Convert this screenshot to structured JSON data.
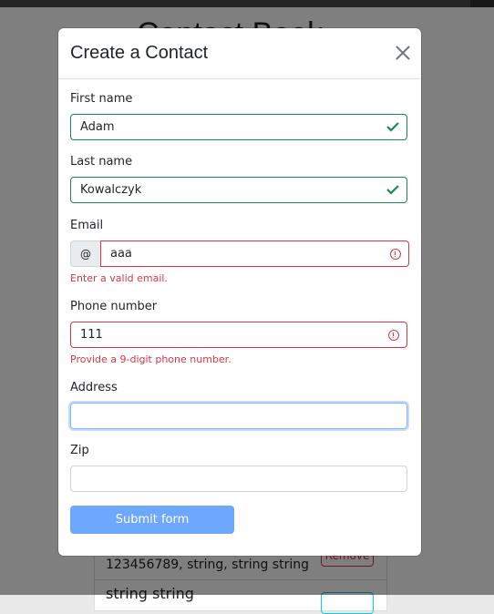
{
  "background": {
    "title": "Contact Book",
    "rows": [
      {
        "text": "123456789, string, string string"
      },
      {
        "text": "string string"
      }
    ],
    "remove_label": "Remove"
  },
  "modal": {
    "title": "Create a Contact",
    "close_icon": "close-icon",
    "fields": {
      "first_name": {
        "label": "First name",
        "value": "Adam",
        "state": "valid"
      },
      "last_name": {
        "label": "Last name",
        "value": "Kowalczyk",
        "state": "valid"
      },
      "email": {
        "label": "Email",
        "prefix": "@",
        "value": "aaa",
        "state": "invalid",
        "feedback": "Enter a valid email."
      },
      "phone": {
        "label": "Phone number",
        "value": "111",
        "state": "invalid",
        "feedback": "Provide a 9-digit phone number."
      },
      "address": {
        "label": "Address",
        "value": "",
        "state": "focused"
      },
      "zip": {
        "label": "Zip",
        "value": ""
      }
    },
    "submit_label": "Submit form"
  },
  "colors": {
    "valid": "#198754",
    "invalid": "#dc3545",
    "primary_disabled": "#6ea8fe"
  }
}
